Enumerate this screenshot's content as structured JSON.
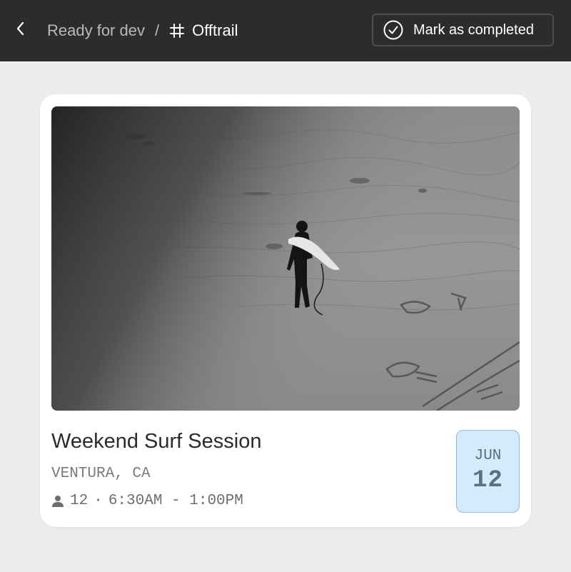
{
  "header": {
    "back_icon": "chevron-left-icon",
    "parent_label": "Ready for dev",
    "separator": "/",
    "frame_icon": "hash-frame-icon",
    "current_label": "Offtrail",
    "complete_icon": "check-circle-icon",
    "complete_label": "Mark as completed"
  },
  "event": {
    "image_description_icon": "photo",
    "title": "Weekend Surf Session",
    "location": "VENTURA, CA",
    "attendee_icon": "person-icon",
    "attendees": "12",
    "separator": "·",
    "time": "6:30AM - 1:00PM",
    "date": {
      "month": "JUN",
      "day": "12"
    }
  },
  "colors": {
    "topbar": "#2c2c2c",
    "page_background": "#ececec",
    "card": "#ffffff",
    "date_badge_bg": "#d3ebfd",
    "date_badge_border": "#8fb9dd",
    "date_text": "#5b6f82"
  }
}
